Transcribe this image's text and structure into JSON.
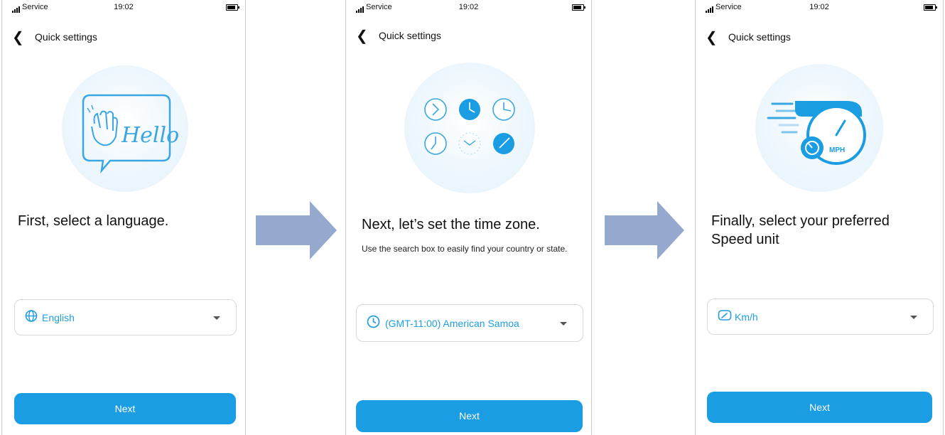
{
  "status": {
    "carrier": "Service",
    "time": "19:02"
  },
  "screens": [
    {
      "nav_title": "Quick settings",
      "illustration_icon": "hello-speech-bubble",
      "illustration_text": "Hello",
      "heading": "First, select a language.",
      "select": {
        "icon": "globe-icon",
        "value": "English"
      },
      "button": "Next"
    },
    {
      "nav_title": "Quick settings",
      "illustration_icon": "world-clocks",
      "heading": "Next, let’s set the time zone.",
      "subtext": "Use the search box to easily find your country or state.",
      "select": {
        "icon": "clock-icon",
        "value": "(GMT-11:00) American Samoa"
      },
      "button": "Next"
    },
    {
      "nav_title": "Quick settings",
      "illustration_icon": "speedometer",
      "illustration_text": "MPH",
      "heading": "Finally, select your preferred Speed unit",
      "select": {
        "icon": "speedometer-icon",
        "value": "Km/h"
      },
      "button": "Next"
    }
  ],
  "colors": {
    "accent": "#1a9de2",
    "arrow": "#95a9cf",
    "illustration_bg": "#e2f1fb"
  }
}
